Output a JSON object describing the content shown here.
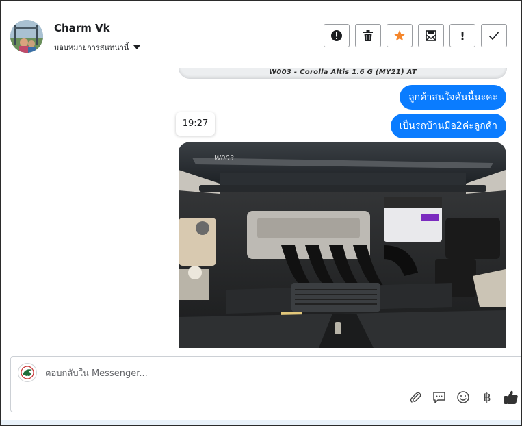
{
  "header": {
    "contact_name": "Charm Vk",
    "assign_label": "มอบหมายการสนทนานี้",
    "actions": [
      {
        "id": "spam",
        "icon": "exclamation-circle-icon"
      },
      {
        "id": "delete",
        "icon": "trash-icon"
      },
      {
        "id": "star",
        "icon": "star-icon",
        "color": "#f5862b"
      },
      {
        "id": "mark-unread",
        "icon": "envelope-icon"
      },
      {
        "id": "follow-up",
        "icon": "exclamation-icon"
      },
      {
        "id": "done",
        "icon": "check-icon"
      }
    ]
  },
  "thread": {
    "previous_caption": "W003 - Corolla Altis 1.6 G (MY21) AT",
    "messages": [
      {
        "text": "ลูกค้าสนใจคันนี้นะคะ"
      },
      {
        "text": "เป็นรถบ้านมือ2ค่ะลูกค้า"
      }
    ],
    "timestamp": "19:27",
    "photo_label": "W003"
  },
  "composer": {
    "placeholder": "ตอบกลับใน Messenger...",
    "tools": [
      "paperclip-icon",
      "saved-reply-icon",
      "emoji-icon",
      "baht-icon",
      "thumbs-up-icon"
    ],
    "baht_symbol": "฿"
  },
  "colors": {
    "bubble": "#0a7cff",
    "accent_star": "#f5862b",
    "border": "#ccd0d5"
  }
}
